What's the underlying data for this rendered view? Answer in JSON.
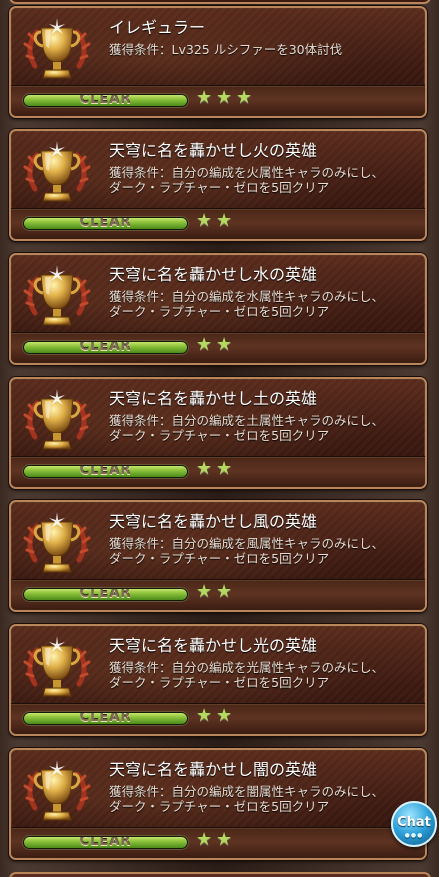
{
  "achievements": [
    {
      "title": "イレギュラー",
      "condition_lines": [
        "獲得条件：Lv325 ルシファーを30体討伐"
      ],
      "status": "CLEAR",
      "progress": 1.0,
      "stars": "★★★"
    },
    {
      "title": "天穹に名を轟かせし火の英雄",
      "condition_lines": [
        "獲得条件：自分の編成を火属性キャラのみにし、",
        "ダーク・ラプチャー・ゼロを5回クリア"
      ],
      "status": "CLEAR",
      "progress": 1.0,
      "stars": "★★"
    },
    {
      "title": "天穹に名を轟かせし水の英雄",
      "condition_lines": [
        "獲得条件：自分の編成を水属性キャラのみにし、",
        "ダーク・ラプチャー・ゼロを5回クリア"
      ],
      "status": "CLEAR",
      "progress": 1.0,
      "stars": "★★"
    },
    {
      "title": "天穹に名を轟かせし土の英雄",
      "condition_lines": [
        "獲得条件：自分の編成を土属性キャラのみにし、",
        "ダーク・ラプチャー・ゼロを5回クリア"
      ],
      "status": "CLEAR",
      "progress": 1.0,
      "stars": "★★"
    },
    {
      "title": "天穹に名を轟かせし風の英雄",
      "condition_lines": [
        "獲得条件：自分の編成を風属性キャラのみにし、",
        "ダーク・ラプチャー・ゼロを5回クリア"
      ],
      "status": "CLEAR",
      "progress": 1.0,
      "stars": "★★"
    },
    {
      "title": "天穹に名を轟かせし光の英雄",
      "condition_lines": [
        "獲得条件：自分の編成を光属性キャラのみにし、",
        "ダーク・ラプチャー・ゼロを5回クリア"
      ],
      "status": "CLEAR",
      "progress": 1.0,
      "stars": "★★"
    },
    {
      "title": "天穹に名を轟かせし闇の英雄",
      "condition_lines": [
        "獲得条件：自分の編成を闇属性キャラのみにし、",
        "ダーク・ラプチャー・ゼロを5回クリア"
      ],
      "status": "CLEAR",
      "progress": 1.0,
      "stars": "★★"
    }
  ],
  "chat_button": {
    "label": "Chat",
    "dots": "●●●"
  },
  "colors": {
    "card_border": "#b8865a",
    "progress_fill": "#8bc13a",
    "star": "#b5d860"
  },
  "icons": {
    "trophy": "trophy-icon",
    "star": "star-icon",
    "chat": "chat-bubble-icon"
  }
}
